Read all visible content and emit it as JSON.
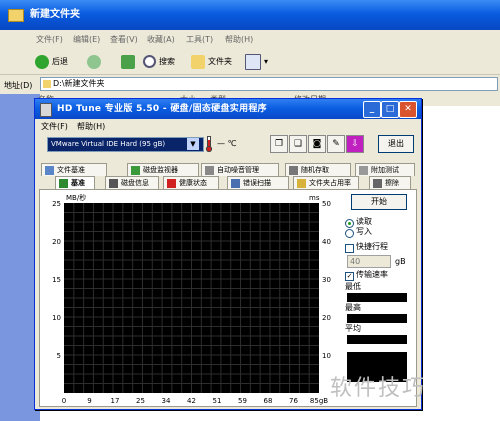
{
  "explorer": {
    "title": "新建文件夹",
    "menu": [
      "文件(F)",
      "编辑(E)",
      "查看(V)",
      "收藏(A)",
      "工具(T)",
      "帮助(H)"
    ],
    "toolbar": {
      "back": "后退",
      "search": "搜索",
      "folders": "文件夹"
    },
    "address_label": "地址(D)",
    "address_value": "D:\\新建文件夹",
    "columns": [
      "名称",
      "大小",
      "类型",
      "修改日期"
    ]
  },
  "hdtune": {
    "title": "HD Tune  专业版 5.50 - 硬盘/固态硬盘实用程序",
    "menu": [
      "文件(F)",
      "帮助(H)"
    ],
    "drive": "VMware Virtual IDE Hard (95 gB)",
    "temperature": "— ℃",
    "exit_label": "退出",
    "tabs_row1": [
      "文件基准",
      "磁盘监视器",
      "自动噪音管理",
      "随机存取",
      "附加测试"
    ],
    "tabs_row2": [
      "基准",
      "磁盘信息",
      "健康状态",
      "错误扫描",
      "文件夹占用率",
      "擦除"
    ],
    "active_tab": "基准",
    "start_label": "开始",
    "read_label": "读取",
    "write_label": "写入",
    "short_stroke_label": "快捷行程",
    "short_stroke_value": "40",
    "short_stroke_unit": "gB",
    "transfer_rate_label": "传输速率",
    "min_label": "最低",
    "max_label": "最高",
    "avg_label": "平均"
  },
  "chart_data": {
    "type": "line",
    "yleft_label": "MB/秒",
    "yright_label": "ms",
    "x": [
      "0",
      "9",
      "17",
      "25",
      "34",
      "42",
      "51",
      "59",
      "68",
      "76",
      "85gB"
    ],
    "yleft_ticks": [
      "25",
      "20",
      "15",
      "10",
      "5"
    ],
    "yright_ticks": [
      "50",
      "40",
      "30",
      "20",
      "10"
    ],
    "ylim_left": [
      0,
      25
    ],
    "ylim_right": [
      0,
      50
    ],
    "grid": true,
    "series": []
  },
  "colors": {
    "chart_bg": "#000000",
    "grid": "#2e2e2e",
    "titlebar": "#0a5ce0"
  },
  "watermark": "软件技巧"
}
